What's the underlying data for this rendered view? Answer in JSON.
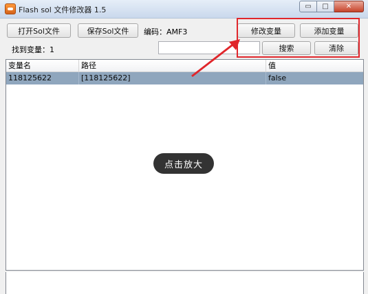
{
  "window": {
    "title": "Flash sol 文件修改器 1.5",
    "controls": {
      "minimize": "▭",
      "maximize": "□",
      "close": "✕"
    }
  },
  "toolbar": {
    "open_sol": "打开Sol文件",
    "save_sol": "保存Sol文件",
    "encoding_label": "编码：",
    "encoding_value": "AMF3",
    "modify_var": "修改变量",
    "add_var": "添加变量"
  },
  "search": {
    "found_label": "找到变量：",
    "found_count": "1",
    "input_value": "",
    "search_button": "搜索",
    "clear_button": "清除"
  },
  "table": {
    "columns": [
      "变量名",
      "路径",
      "值"
    ],
    "rows": [
      [
        "118125622",
        "[118125622]",
        "false"
      ]
    ]
  },
  "overlay": {
    "zoom_hint": "点击放大"
  },
  "colors": {
    "highlight": "#e0262b",
    "selected_row": "#8fa6bd"
  }
}
